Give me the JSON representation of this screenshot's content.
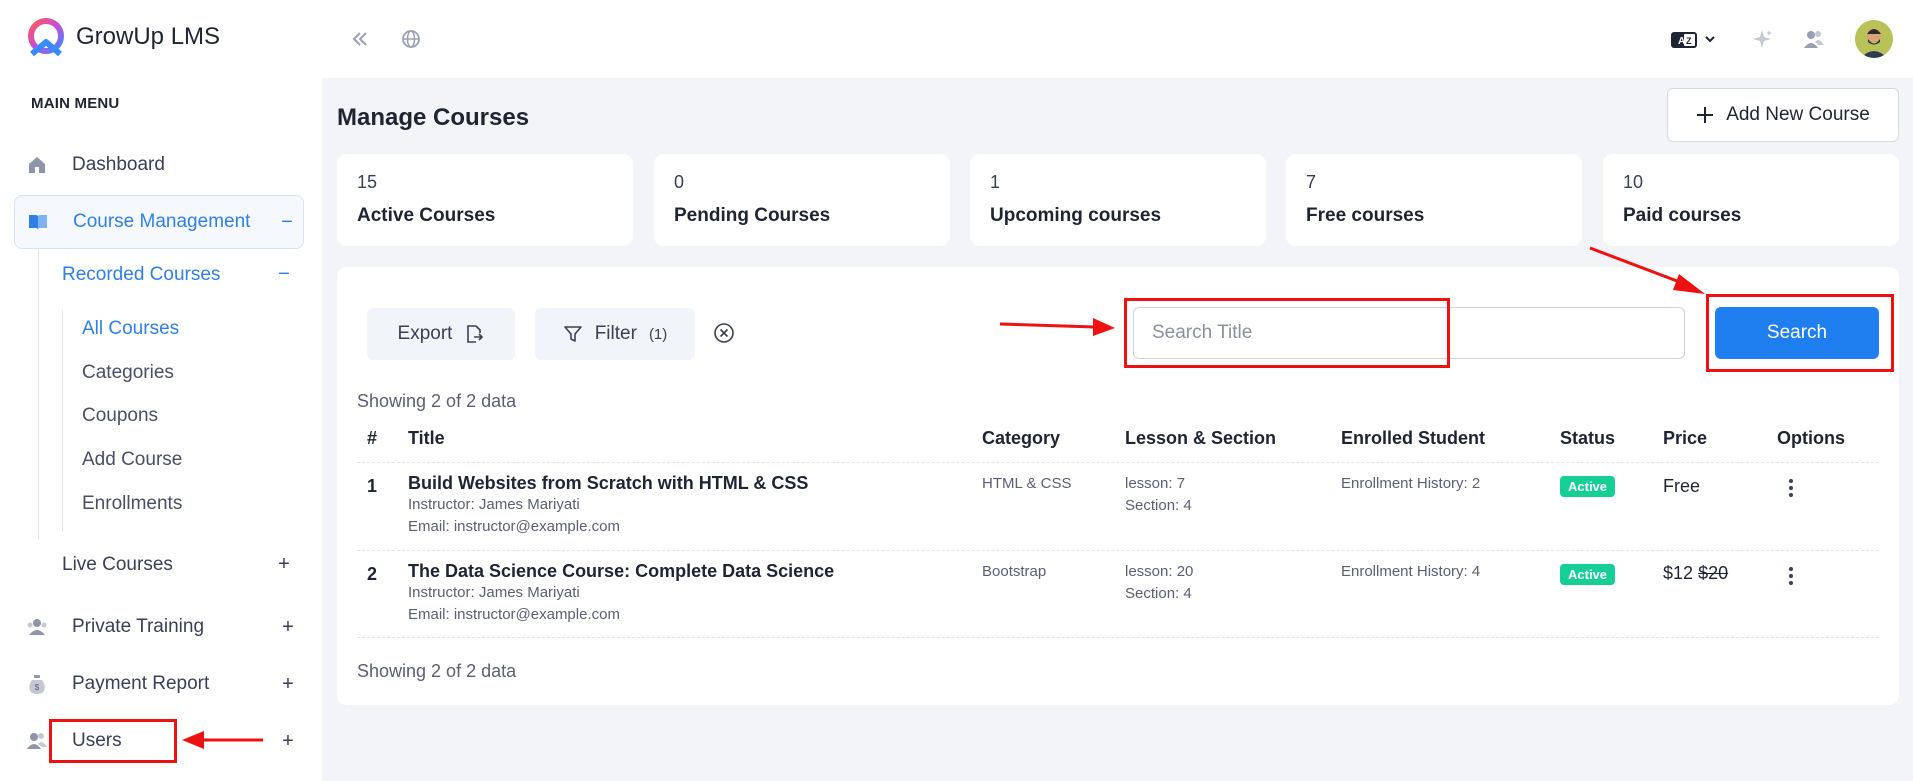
{
  "brand": {
    "name": "GrowUp LMS"
  },
  "sidebar": {
    "heading": "MAIN MENU",
    "dashboard": "Dashboard",
    "course_management": {
      "label": "Course Management",
      "sign": "−"
    },
    "recorded_courses": {
      "label": "Recorded Courses",
      "sign": "−"
    },
    "leaves": [
      "All Courses",
      "Categories",
      "Coupons",
      "Add Course",
      "Enrollments"
    ],
    "live_courses": {
      "label": "Live Courses",
      "sign": "+"
    },
    "private_training": {
      "label": "Private Training",
      "sign": "+"
    },
    "payment_report": {
      "label": "Payment Report",
      "sign": "+"
    },
    "users": {
      "label": "Users",
      "sign": "+"
    }
  },
  "topbar": {
    "icons": [
      "collapse-sidebar-icon",
      "globe-icon",
      "language-icon",
      "sparkle-icon",
      "users-icon",
      "avatar"
    ]
  },
  "main": {
    "title": "Manage Courses",
    "add_button": "Add New Course",
    "stats": [
      {
        "num": "15",
        "label": "Active Courses"
      },
      {
        "num": "0",
        "label": "Pending Courses"
      },
      {
        "num": "1",
        "label": "Upcoming courses"
      },
      {
        "num": "7",
        "label": "Free courses"
      },
      {
        "num": "10",
        "label": "Paid courses"
      }
    ],
    "toolbar": {
      "export": "Export",
      "filter": "Filter",
      "filter_count": "(1)",
      "search_placeholder": "Search Title",
      "search_button": "Search"
    },
    "showing_top": "Showing 2 of 2 data",
    "showing_bottom": "Showing 2 of 2 data",
    "table": {
      "headers": [
        "#",
        "Title",
        "Category",
        "Lesson & Section",
        "Enrolled Student",
        "Status",
        "Price",
        "Options"
      ],
      "rows": [
        {
          "idx": "1",
          "title": "Build Websites from Scratch with HTML & CSS",
          "instructor": "Instructor: James Mariyati",
          "email": "Email: instructor@example.com",
          "category": "HTML & CSS",
          "lesson": "lesson: 7",
          "section": "Section: 4",
          "enrolled": "Enrollment History: 2",
          "status": "Active",
          "price": "Free",
          "old_price": ""
        },
        {
          "idx": "2",
          "title": "The Data Science Course: Complete Data Science",
          "instructor": "Instructor: James Mariyati",
          "email": "Email: instructor@example.com",
          "category": "Bootstrap",
          "lesson": "lesson: 20",
          "section": "Section: 4",
          "enrolled": "Enrollment History: 4",
          "status": "Active",
          "price": "$12",
          "old_price": "$20"
        }
      ]
    }
  },
  "colors": {
    "accent": "#1f7ff0",
    "active_badge": "#16cf97",
    "annotation": "#ee1111"
  }
}
